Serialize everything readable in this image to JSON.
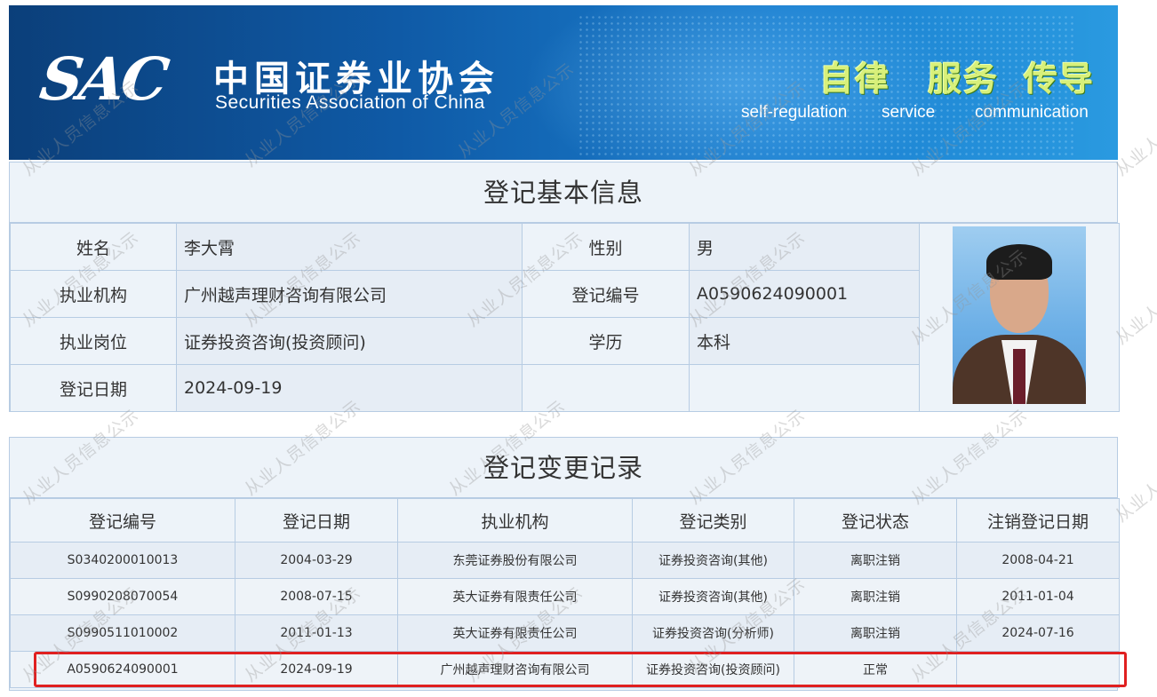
{
  "banner": {
    "logo_text": "SAC",
    "org_cn": "中国证券业协会",
    "org_en": "Securities Association of China",
    "slogans": [
      {
        "cn": "自律",
        "en": "self-regulation"
      },
      {
        "cn": "服务",
        "en": "service"
      },
      {
        "cn": "传导",
        "en": "communication"
      }
    ]
  },
  "basic_info": {
    "title": "登记基本信息",
    "rows": [
      {
        "label1": "姓名",
        "value1": "李大霄",
        "label2": "性别",
        "value2": "男"
      },
      {
        "label1": "执业机构",
        "value1": "广州越声理财咨询有限公司",
        "label2": "登记编号",
        "value2": "A0590624090001"
      },
      {
        "label1": "执业岗位",
        "value1": "证券投资咨询(投资顾问)",
        "label2": "学历",
        "value2": "本科"
      },
      {
        "label1": "登记日期",
        "value1": "2024-09-19",
        "label2": "",
        "value2": ""
      }
    ]
  },
  "change_records": {
    "title": "登记变更记录",
    "headers": [
      "登记编号",
      "登记日期",
      "执业机构",
      "登记类别",
      "登记状态",
      "注销登记日期"
    ],
    "rows": [
      [
        "S0340200010013",
        "2004-03-29",
        "东莞证券股份有限公司",
        "证券投资咨询(其他)",
        "离职注销",
        "2008-04-21"
      ],
      [
        "S0990208070054",
        "2008-07-15",
        "英大证券有限责任公司",
        "证券投资咨询(其他)",
        "离职注销",
        "2011-01-04"
      ],
      [
        "S0990511010002",
        "2011-01-13",
        "英大证券有限责任公司",
        "证券投资咨询(分析师)",
        "离职注销",
        "2024-07-16"
      ],
      [
        "A0590624090001",
        "2024-09-19",
        "广州越声理财咨询有限公司",
        "证券投资咨询(投资顾问)",
        "正常",
        ""
      ]
    ]
  },
  "watermark_text": "从业人员信息公示",
  "colors": {
    "highlight": "#e02020",
    "panel_bg": "#edf3f9",
    "border": "#b7cce3"
  }
}
